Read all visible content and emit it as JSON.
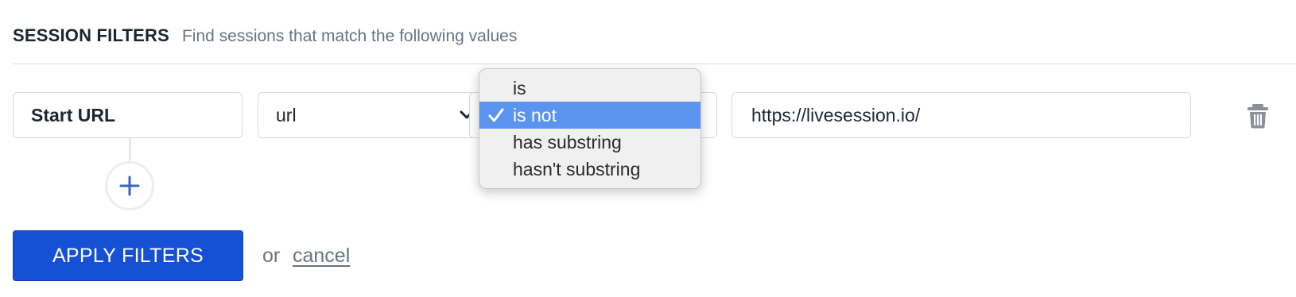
{
  "header": {
    "title": "SESSION FILTERS",
    "subtitle": "Find sessions that match the following values"
  },
  "filter": {
    "type_label": "Start URL",
    "property": "url",
    "value": "https://livesession.io/"
  },
  "operator_dropdown": {
    "options": [
      "is",
      "is not",
      "has substring",
      "hasn't substring"
    ],
    "selected": "is not",
    "highlight_color": "#5b93f1"
  },
  "actions": {
    "apply_label": "APPLY FILTERS",
    "or_label": "or",
    "cancel_label": "cancel"
  },
  "icons": {
    "chevron": "chevron-down-icon",
    "trash": "trash-icon",
    "add": "plus-icon",
    "check": "checkmark-icon"
  },
  "colors": {
    "primary": "#1650d6",
    "accent": "#3a66c4",
    "muted_text": "#6b7280"
  }
}
